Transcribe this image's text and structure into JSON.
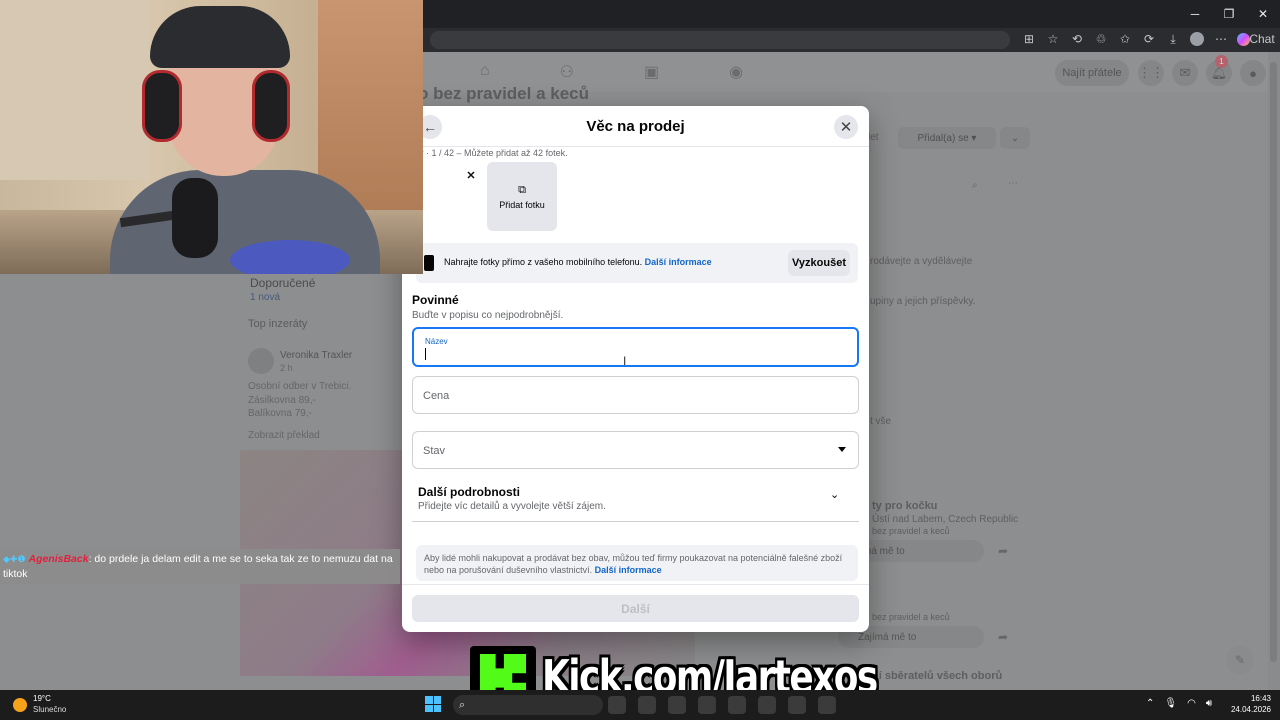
{
  "browser": {
    "chat_label": "Chat"
  },
  "facebook": {
    "find_friends": "Najít přátele",
    "notification_count": "1",
    "group_title": "o bez pravidel a keců",
    "joined_label": "Přidal(a) se",
    "left_col": {
      "recommended": "Doporučené",
      "new_count": "1 nová",
      "top_ads": "Top inzeráty",
      "post_author": "Veronika Traxler",
      "post_time": "2 h",
      "post_lines": [
        "Osobní odber v Trebici.",
        "Zásilkovna 89,-",
        "Balíkovna 79,-"
      ],
      "translate": "Zobrazit překlad"
    },
    "right_col": {
      "text1": "rodávejte a vydělávejte",
      "text2": "upiny a jejich příspěvky.",
      "see_all": "t vše",
      "post_title": "ty pro kočku",
      "post_place": "Ústí nad Labem, Czech Republic",
      "post_group": "bez pravidel a keců",
      "interested": "jímá mě to",
      "footer_group": "bez pravidel a keců",
      "interested2": "Zajímá mě to",
      "bottom_text": "ní sběratelů všech oborů",
      "let_label": "let"
    }
  },
  "modal": {
    "title": "Věc na prodej",
    "photo_count": "tky · 1 / 42 – Můžete přidat až 42 fotek.",
    "add_photo": "Přidat fotku",
    "mobile_text": "Nahrajte fotky přímo z vašeho mobilního telefonu.",
    "mobile_link": "Další informace",
    "try_button": "Vyzkoušet",
    "required_title": "Povinné",
    "required_sub": "Buďte v popisu co nejpodrobnější.",
    "fields": {
      "name_label": "Název",
      "price_placeholder": "Cena",
      "condition_placeholder": "Stav"
    },
    "more_details_title": "Další podrobnosti",
    "more_details_sub": "Přidejte víc detailů a vyvolejte větší zájem.",
    "notice_text": "Aby lidé mohli nakupovat a prodávat bez obav, můžou teď firmy poukazovat na potenciálně falešné zboží nebo na porušování duševního vlastnictví.",
    "notice_link": "Další informace",
    "next_button": "Další"
  },
  "chat_overlay": {
    "username": "AgenisBack",
    "message": ": do prdele ja delam edit a me se to seka tak ze to nemuzu dat na tiktok"
  },
  "kick_banner": {
    "text": "Kick.com/Jartexos"
  },
  "taskbar": {
    "temperature": "19°C",
    "weather": "Slunečno",
    "time": "16:43",
    "date": "24.04.2026"
  },
  "colors": {
    "accent": "#1877f2",
    "link": "#1366c7",
    "kick_green": "#53fc18"
  }
}
